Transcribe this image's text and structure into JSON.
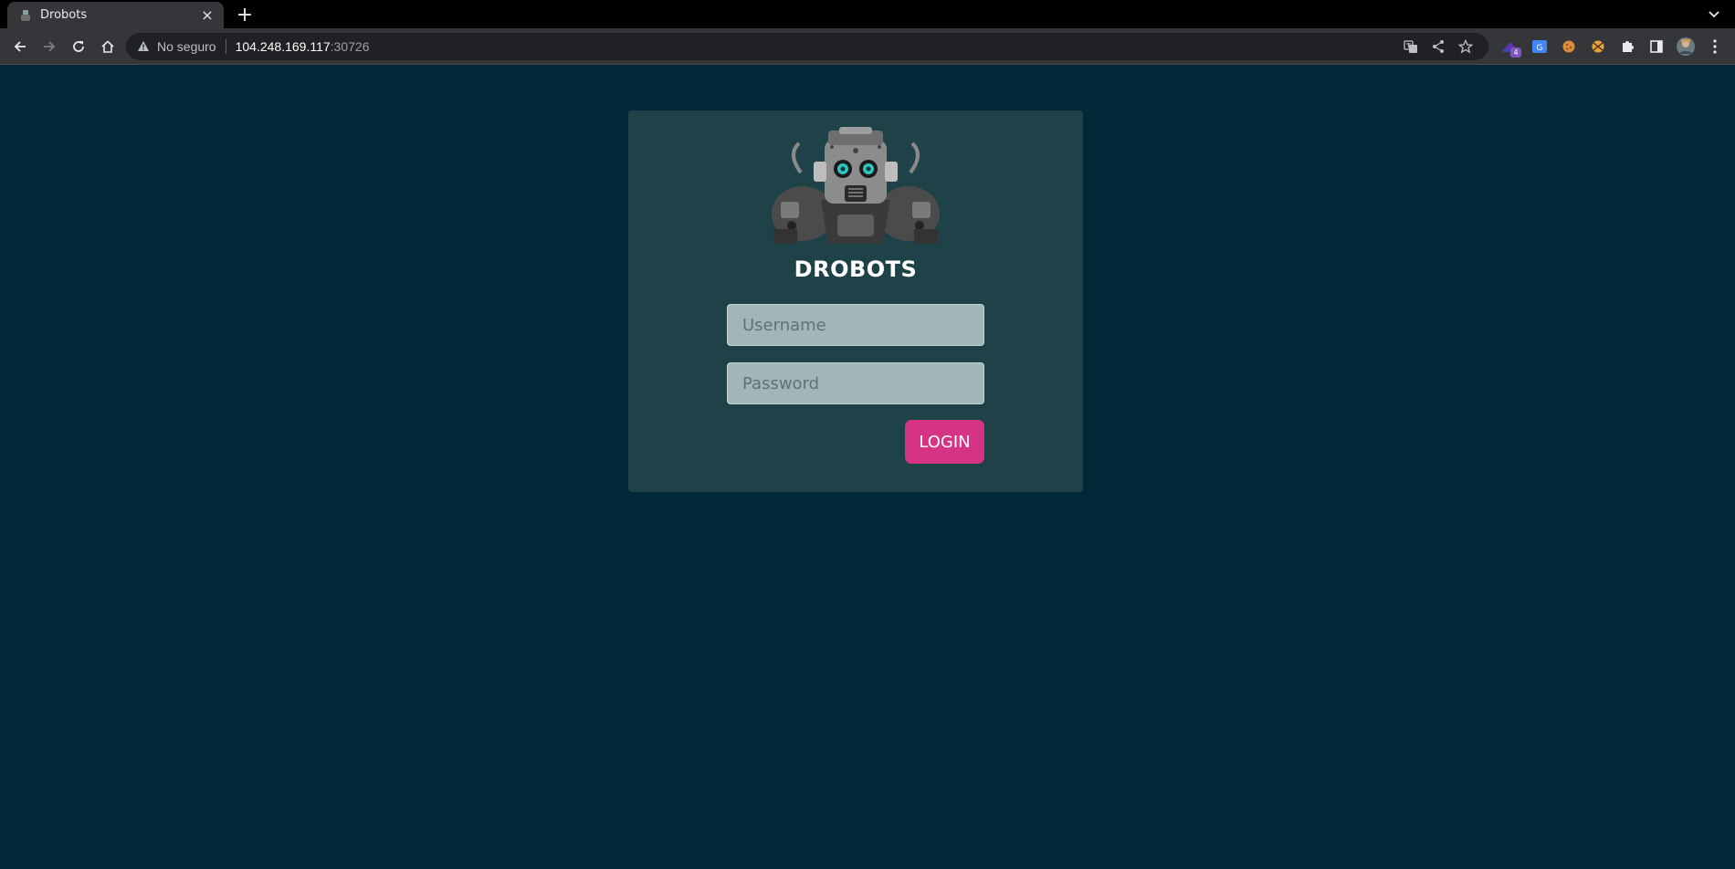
{
  "browser": {
    "tab": {
      "title": "Drobots",
      "close_glyph": "×",
      "icon": "robot-favicon-icon"
    },
    "new_tab_glyph": "+",
    "address": {
      "security_label": "No seguro",
      "host": "104.248.169.117",
      "port": ":30726"
    },
    "icons": {
      "back": "back-arrow-icon",
      "forward": "forward-arrow-icon",
      "reload": "reload-icon",
      "home": "home-icon",
      "translate": "translate-icon",
      "share": "share-icon",
      "bookmark": "star-icon",
      "extensions": "puzzle-icon",
      "sidepanel": "side-panel-icon",
      "profile": "profile-avatar-icon",
      "menu": "kebab-menu-icon"
    },
    "extension_badge": "4"
  },
  "page": {
    "brand": "DROBOTS",
    "username": {
      "placeholder": "Username",
      "value": ""
    },
    "password": {
      "placeholder": "Password",
      "value": ""
    },
    "login_label": "LOGIN",
    "colors": {
      "background": "#002837",
      "card": "#1f4248",
      "input": "#a3b6b7",
      "button": "#d63384"
    }
  }
}
